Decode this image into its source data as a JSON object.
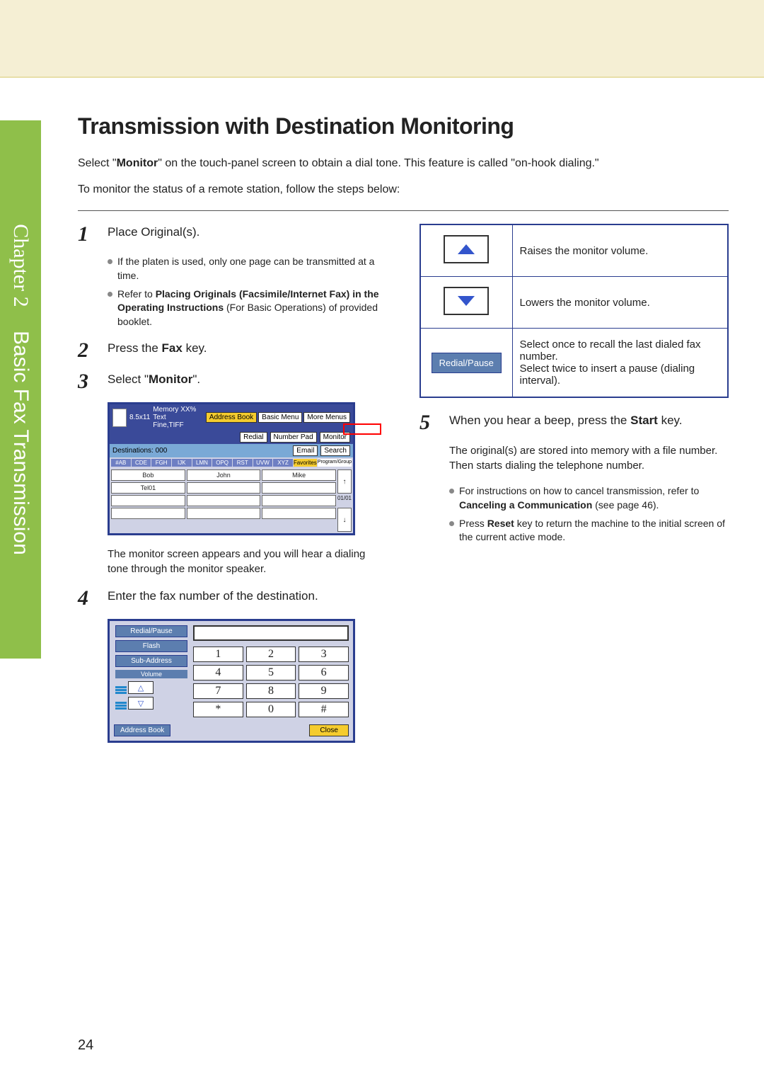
{
  "document": {
    "chapter_label": "Chapter 2",
    "chapter_subtitle": "Basic Fax Transmission",
    "page_number": "24",
    "title": "Transmission with Destination Monitoring",
    "intro1_pre": "Select \"",
    "intro1_bold": "Monitor",
    "intro1_post": "\" on the touch-panel screen to obtain a dial tone. This feature is called \"on-hook dialing.\"",
    "intro2": "To monitor the status of a remote station, follow the steps below:"
  },
  "step1": {
    "num": "1",
    "title": "Place Original(s).",
    "b1": "If the platen is used, only one page can be transmitted at a time.",
    "b2_pre": "Refer to ",
    "b2_bold": "Placing Originals (Facsimile/Internet Fax) in the Operating Instructions",
    "b2_post": " (For Basic Operations) of provided booklet."
  },
  "step2": {
    "num": "2",
    "pre": "Press the ",
    "bold": "Fax",
    "post": " key."
  },
  "step3": {
    "num": "3",
    "pre": "Select \"",
    "bold": "Monitor",
    "post": "\".",
    "after": "The monitor screen appears and you will hear a dialing tone through the monitor speaker."
  },
  "step4": {
    "num": "4",
    "title": "Enter the fax number of the destination."
  },
  "step5": {
    "num": "5",
    "pre": "When you hear a beep, press the ",
    "bold": "Start",
    "post": " key.",
    "sub": "The original(s) are stored into memory with a file number. Then starts dialing the telephone number.",
    "b1_pre": "For instructions on how to cancel transmission, refer to ",
    "b1_bold": "Canceling a Communication",
    "b1_post": " (see page 46).",
    "b2_pre": "Press ",
    "b2_bold": "Reset",
    "b2_post": " key to return the machine to the initial screen of the current active mode."
  },
  "abook": {
    "status_size": "8.5x11",
    "status_mem": "Memory XX%",
    "status_text": "Text",
    "status_fine": "Fine,TIFF",
    "btn_addr": "Address Book",
    "btn_basic": "Basic Menu",
    "btn_more": "More Menus",
    "btn_redial": "Redial",
    "btn_numpad": "Number Pad",
    "btn_monitor": "Monitor",
    "dest_label": "Destinations: 000",
    "btn_email": "Email",
    "btn_search": "Search",
    "tabs": [
      "#AB",
      "CDE",
      "FGH",
      "IJK",
      "LMN",
      "OPQ",
      "RST",
      "UVW",
      "XYZ",
      "Favorites",
      "Program/Group"
    ],
    "contacts_r1": [
      "Bob",
      "John",
      "Mike"
    ],
    "contacts_r2": [
      "Tel01",
      "",
      ""
    ],
    "page_ind": "01/01"
  },
  "dpad": {
    "btn_redial_pause": "Redial/Pause",
    "btn_flash": "Flash",
    "btn_sub": "Sub-Address",
    "lbl_volume": "Volume",
    "keys": [
      "1",
      "2",
      "3",
      "4",
      "5",
      "6",
      "7",
      "8",
      "9",
      "*",
      "0",
      "#"
    ],
    "btn_addr": "Address Book",
    "btn_close": "Close"
  },
  "vtable": {
    "row1": "Raises the monitor volume.",
    "row2": "Lowers the monitor volume.",
    "row3_btn": "Redial/Pause",
    "row3a": "Select once to recall the last dialed fax number.",
    "row3b": "Select twice to insert a pause (dialing interval)."
  }
}
